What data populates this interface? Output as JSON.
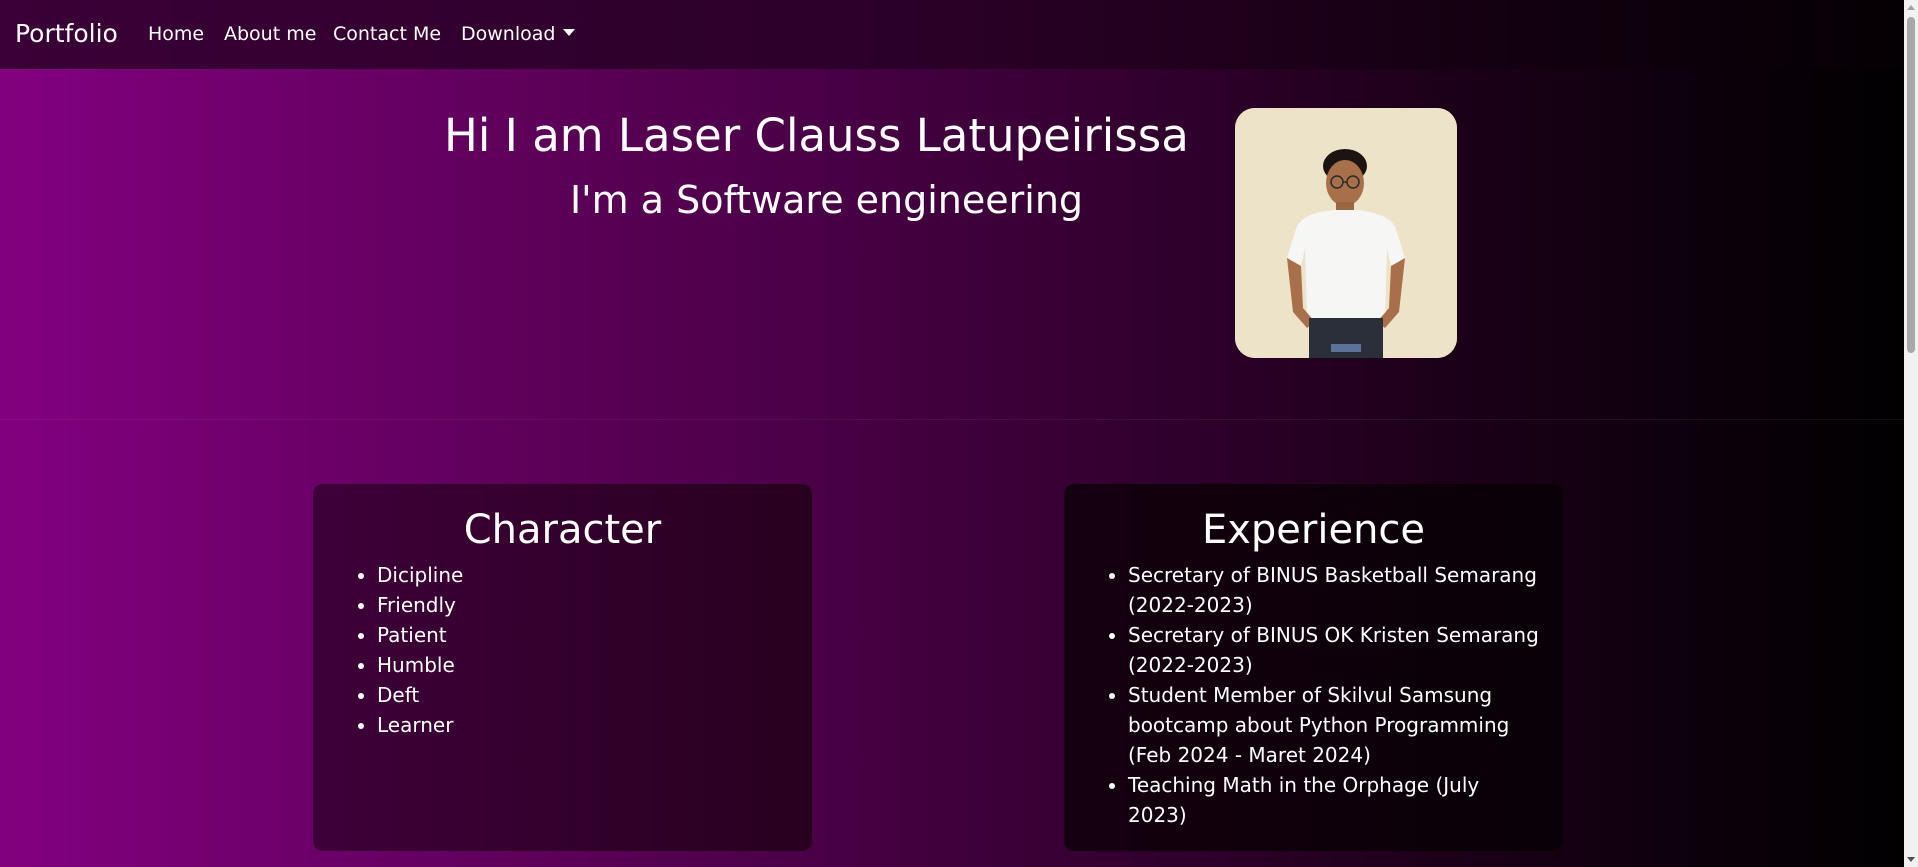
{
  "navbar": {
    "brand": "Portfolio",
    "items": [
      {
        "label": "Home"
      },
      {
        "label": "About me"
      },
      {
        "label": "Contact Me"
      },
      {
        "label": "Download"
      }
    ]
  },
  "hero": {
    "title": "Hi I am Laser Clauss Latupeirissa",
    "subtitle": "I'm a Software engineering"
  },
  "character": {
    "title": "Character",
    "items": [
      "Dicipline",
      "Friendly",
      "Patient",
      "Humble",
      "Deft",
      "Learner"
    ]
  },
  "experience": {
    "title": "Experience",
    "items": [
      "Secretary of BINUS Basketball Semarang (2022-2023)",
      "Secretary of BINUS OK Kristen Semarang (2022-2023)",
      "Student Member of Skilvul Samsung bootcamp about Python Programming (Feb 2024 - Maret 2024)",
      "Teaching Math in the Orphage (July 2023)"
    ]
  },
  "colors": {
    "gradient_start": "#82007f",
    "gradient_end": "#000000",
    "photo_background": "#ede3c8"
  }
}
